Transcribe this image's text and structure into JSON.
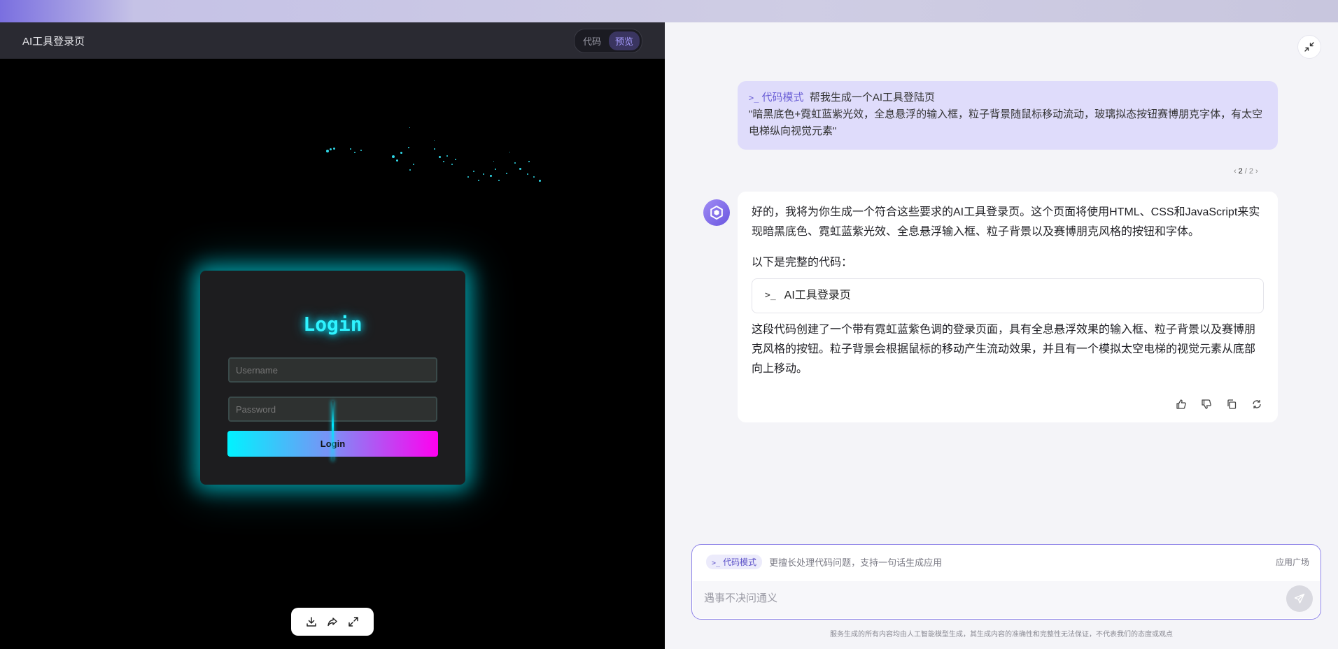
{
  "preview": {
    "title": "AI工具登录页",
    "mode_toggle": {
      "code_label": "代码",
      "preview_label": "预览",
      "active": "预览"
    },
    "login": {
      "heading": "Login",
      "username_placeholder": "Username",
      "password_placeholder": "Password",
      "button_label": "Login"
    },
    "toolbar": [
      "download-icon",
      "share-icon",
      "fullscreen-icon"
    ]
  },
  "chat": {
    "user_message": {
      "mode_label": "代码模式",
      "line1": "帮我生成一个AI工具登陆页",
      "line2": "\"暗黑底色+霓虹蓝紫光效，全息悬浮的输入框，粒子背景随鼠标移动流动，玻璃拟态按钮赛博朋克字体，有太空电梯纵向视觉元素\""
    },
    "pager": {
      "current": "2",
      "total": "2"
    },
    "assistant_message": {
      "intro": "好的，我将为你生成一个符合这些要求的AI工具登录页。这个页面将使用HTML、CSS和JavaScript来实现暗黑底色、霓虹蓝紫光效、全息悬浮输入框、粒子背景以及赛博朋克风格的按钮和字体。",
      "lead": "以下是完整的代码：",
      "code_card_title": "AI工具登录页",
      "summary": "这段代码创建了一个带有霓虹蓝紫色调的登录页面，具有全息悬浮效果的输入框、粒子背景以及赛博朋克风格的按钮。粒子背景会根据鼠标的移动产生流动效果，并且有一个模拟太空电梯的视觉元素从底部向上移动。"
    },
    "message_actions": [
      "thumbs-up-icon",
      "thumbs-down-icon",
      "copy-icon",
      "regenerate-icon"
    ]
  },
  "composer": {
    "mode_label": "代码模式",
    "hint": "更擅长处理代码问题，支持一句话生成应用",
    "plaza_label": "应用广场",
    "placeholder": "遇事不决问通义"
  },
  "disclaimer": "服务生成的所有内容均由人工智能模型生成，其生成内容的准确性和完整性无法保证，不代表我们的态度或观点"
}
